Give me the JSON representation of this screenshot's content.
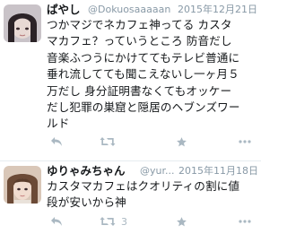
{
  "tweets": [
    {
      "name": "ぱやし",
      "handle": "@Dokuosaaaaan",
      "date": "2015年12月21日",
      "text": "つかマジでネカフェ神ってる カスタ\nマカフェ？っていうところ 防音だし\n音楽ふつうにかけててもテレビ普通に\n垂れ流してても聞こえないし一ヶ月５\n万だし 身分証明書なくてもオッケー\nだし犯罪の巣窟と隠居のヘブンズワー\nルド",
      "retweet_count": ""
    },
    {
      "name": "ゆりゃみちゃん",
      "handle": "@yur...",
      "date": "2015年11月18日",
      "text": "カスタマカフェはクオリティの割に値\n段が安いから神",
      "retweet_count": "3"
    }
  ],
  "icons": {
    "reply": "reply-icon",
    "retweet": "retweet-icon",
    "like": "star-icon",
    "more": "more-icon"
  },
  "colors": {
    "text": "#14171a",
    "muted": "#8899a6",
    "action": "#aab8c2"
  }
}
